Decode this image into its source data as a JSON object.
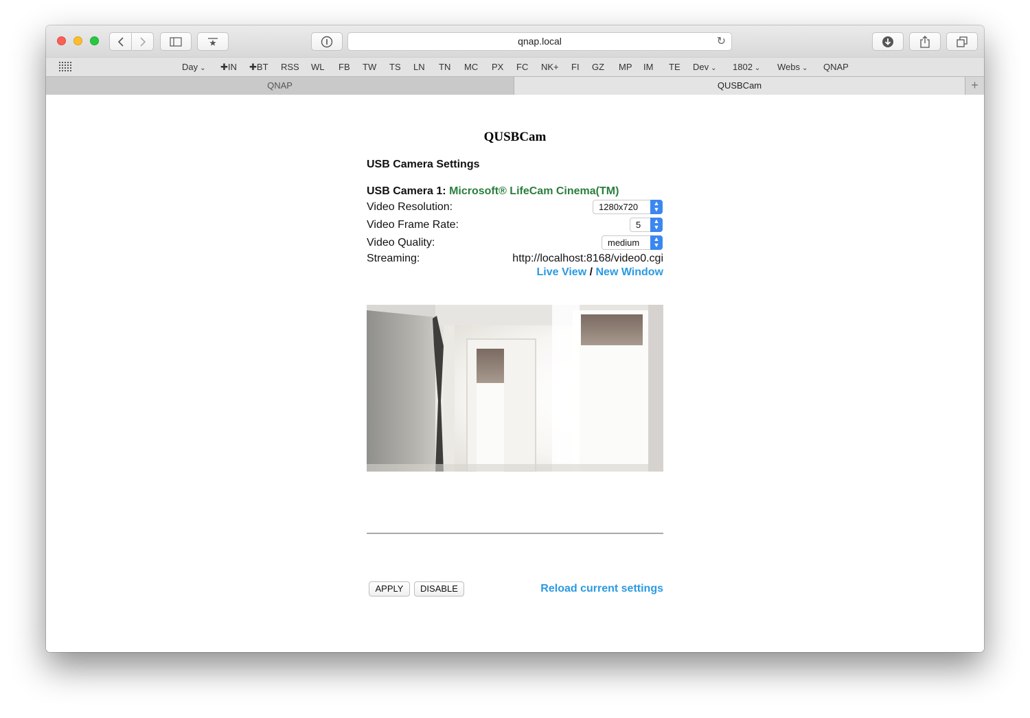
{
  "browser": {
    "address": "qnap.local",
    "favorites": [
      {
        "label": "Day",
        "dropdown": true
      },
      {
        "label": "✚IN",
        "dropdown": false
      },
      {
        "label": "✚BT",
        "dropdown": false
      },
      {
        "label": "RSS",
        "dropdown": false
      },
      {
        "label": "WL",
        "dropdown": false
      },
      {
        "label": "FB",
        "dropdown": false
      },
      {
        "label": "TW",
        "dropdown": false
      },
      {
        "label": "TS",
        "dropdown": false
      },
      {
        "label": "LN",
        "dropdown": false
      },
      {
        "label": "TN",
        "dropdown": false
      },
      {
        "label": "MC",
        "dropdown": false
      },
      {
        "label": "PX",
        "dropdown": false
      },
      {
        "label": "FC",
        "dropdown": false
      },
      {
        "label": "NK+",
        "dropdown": false
      },
      {
        "label": "FI",
        "dropdown": false
      },
      {
        "label": "GZ",
        "dropdown": false
      },
      {
        "label": "MP",
        "dropdown": false
      },
      {
        "label": "IM",
        "dropdown": false
      },
      {
        "label": "TE",
        "dropdown": false
      },
      {
        "label": "Dev",
        "dropdown": true
      },
      {
        "label": "1802",
        "dropdown": true
      },
      {
        "label": "Webs",
        "dropdown": true
      },
      {
        "label": "QNAP",
        "dropdown": false
      }
    ],
    "tabs": [
      {
        "label": "QNAP",
        "active": false
      },
      {
        "label": "QUSBCam",
        "active": true
      }
    ],
    "icons": {
      "back": "chevron-left-icon",
      "forward": "chevron-right-icon",
      "sidebar": "sidebar-icon",
      "bookmarks": "top-sites-icon",
      "reader": "info-icon",
      "reload": "reload-icon",
      "download": "download-icon",
      "share": "share-icon",
      "tabs": "tab-overview-icon",
      "new_tab": "plus-icon"
    }
  },
  "page": {
    "title": "QUSBCam",
    "settings_heading": "USB Camera Settings",
    "camera_label": "USB Camera 1:",
    "camera_name": "Microsoft® LifeCam Cinema(TM)",
    "camera_name_color": "#2a7e3d",
    "resolution_label": "Video Resolution:",
    "resolution_value": "1280x720",
    "framerate_label": "Video Frame Rate:",
    "framerate_value": "5",
    "quality_label": "Video Quality:",
    "quality_value": "medium",
    "streaming_label": "Streaming:",
    "streaming_url": "http://localhost:8168/video0.cgi",
    "live_view_link": "Live View",
    "link_separator": " / ",
    "new_window_link": "New Window",
    "link_color": "#2a9ae2",
    "apply_button": "APPLY",
    "disable_button": "DISABLE",
    "reload_link": "Reload current settings"
  }
}
